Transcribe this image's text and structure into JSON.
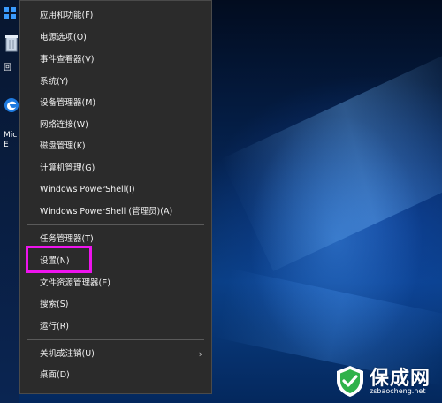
{
  "desktop": {
    "icons": [
      {
        "name": "recycle-bin",
        "label": "回"
      },
      {
        "name": "edge",
        "label": "Mic\nE"
      }
    ]
  },
  "context_menu": {
    "items": [
      {
        "label": "应用和功能(F)"
      },
      {
        "label": "电源选项(O)"
      },
      {
        "label": "事件查看器(V)"
      },
      {
        "label": "系统(Y)"
      },
      {
        "label": "设备管理器(M)"
      },
      {
        "label": "网络连接(W)"
      },
      {
        "label": "磁盘管理(K)"
      },
      {
        "label": "计算机管理(G)"
      },
      {
        "label": "Windows PowerShell(I)"
      },
      {
        "label": "Windows PowerShell (管理员)(A)"
      },
      {
        "label": "任务管理器(T)"
      },
      {
        "label": "设置(N)",
        "highlighted": true
      },
      {
        "label": "文件资源管理器(E)"
      },
      {
        "label": "搜索(S)"
      },
      {
        "label": "运行(R)"
      },
      {
        "label": "关机或注销(U)",
        "has_submenu": true
      },
      {
        "label": "桌面(D)"
      }
    ],
    "highlight_color": "#ee14ee"
  },
  "watermark": {
    "title": "保成网",
    "url": "zsbaocheng.net"
  },
  "colors": {
    "menu_bg": "#2b2b2b",
    "menu_text": "#f2f2f2",
    "accent_blue": "#3a9bff",
    "watermark_green": "#2fb24a"
  },
  "icons": {
    "start": "windows-logo-icon",
    "submenu": "chevron-right-icon"
  }
}
